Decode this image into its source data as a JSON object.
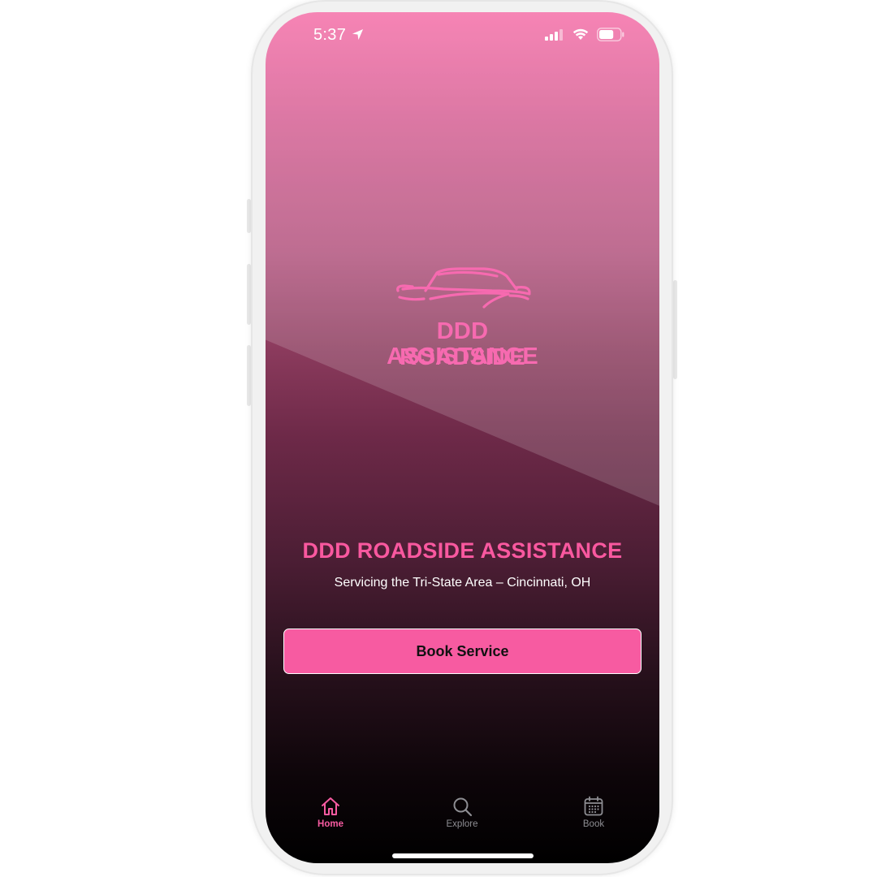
{
  "status_bar": {
    "time": "5:37",
    "icons": [
      "location-arrow-icon",
      "cellular-signal-icon",
      "wifi-icon",
      "battery-icon"
    ],
    "battery_level": 0.7
  },
  "logo": {
    "icon": "car-silhouette-icon",
    "line1": "DDD ROADSIDE",
    "line2": "ASSISTANCE"
  },
  "hero": {
    "title": "DDD ROADSIDE ASSISTANCE",
    "subtitle": "Servicing the Tri-State Area – Cincinnati, OH"
  },
  "cta": {
    "label": "Book Service"
  },
  "tab_bar": {
    "tabs": [
      {
        "label": "Home",
        "icon": "home-icon",
        "active": true
      },
      {
        "label": "Explore",
        "icon": "search-icon",
        "active": false
      },
      {
        "label": "Book",
        "icon": "calendar-icon",
        "active": false
      }
    ]
  },
  "colors": {
    "accent": "#f75ba1",
    "brand_pink": "#f76ab0",
    "tab_active": "#f75ba1",
    "tab_inactive": "#8e8e93"
  }
}
